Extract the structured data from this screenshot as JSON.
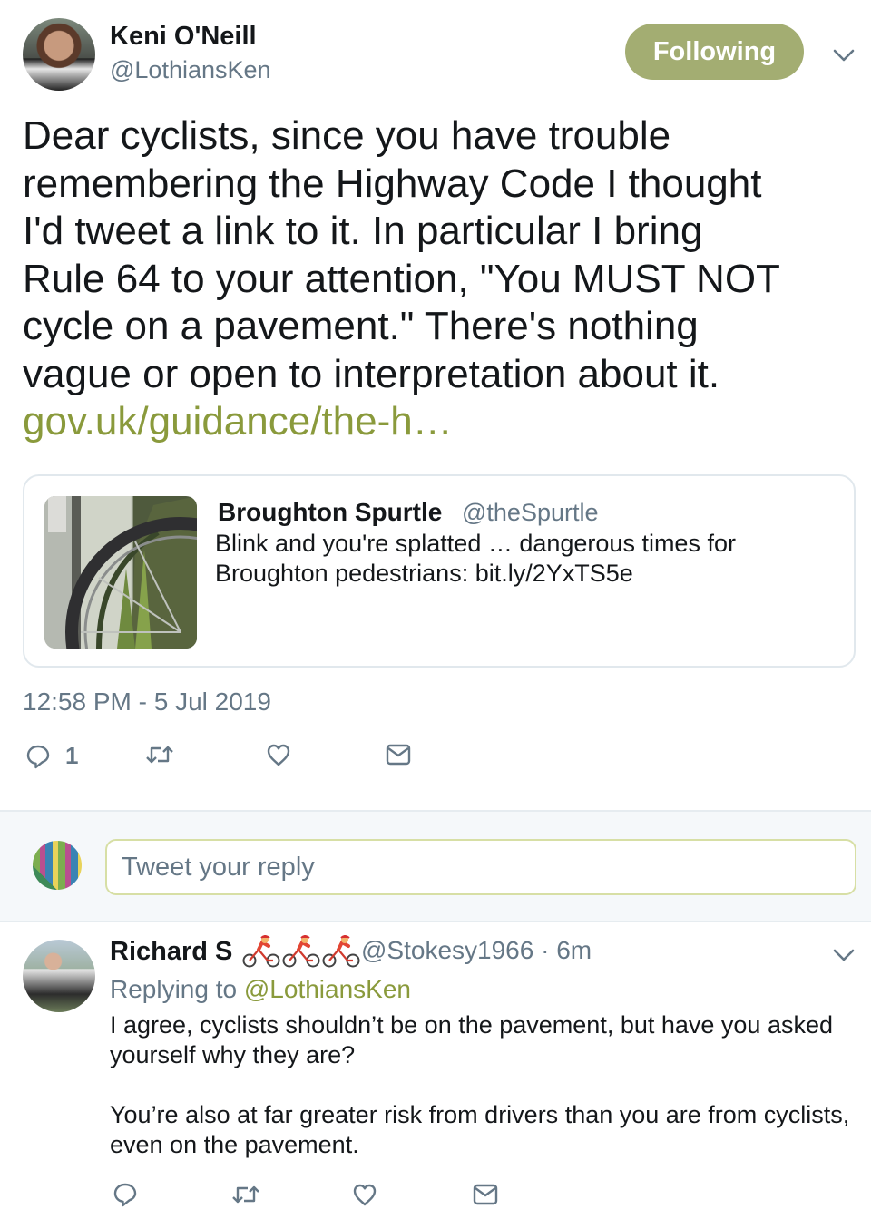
{
  "main_tweet": {
    "author_name": "Keni O'Neill",
    "author_handle": "@LothiansKen",
    "follow_label": "Following",
    "text_lines": [
      "Dear cyclists, since you have trouble",
      "remembering the Highway Code I thought",
      "I'd tweet a link to it. In particular I bring",
      "Rule 64 to your attention, \"You MUST NOT",
      "cycle on a pavement.\" There's nothing",
      "vague or open to interpretation about it."
    ],
    "link": "gov.uk/guidance/the-h…",
    "timestamp": "12:58 PM - 5 Jul 2019",
    "reply_count": "1"
  },
  "quoted_tweet": {
    "author_name": "Broughton Spurtle",
    "author_handle": "@theSpurtle",
    "text": "Blink and you're splatted … dangerous times for Broughton pedestrians: bit.ly/2YxTS5e"
  },
  "composer": {
    "placeholder": "Tweet your reply"
  },
  "reply_tweet": {
    "author_name": "Richard S",
    "author_handle": "@Stokesy1966",
    "age": "6m",
    "meta": "@Stokesy1966 · 6m",
    "replying_label": "Replying to",
    "replying_handle": "@LothiansKen",
    "paragraphs": [
      "I agree, cyclists shouldn’t be on the pavement, but have you asked yourself why they are?",
      "You’re also at far greater risk from drivers than you are from cyclists, even on the pavement."
    ]
  },
  "icons": [
    "chevron-down-icon",
    "reply-icon",
    "retweet-icon",
    "like-icon",
    "direct-message-icon",
    "cyclist-emoji"
  ],
  "colors": {
    "follow_button": "#a3ad72",
    "link": "#8a9a3c",
    "secondary_text": "#657786",
    "border": "#e1e8ed",
    "composer_band": "#f5f8fa"
  }
}
